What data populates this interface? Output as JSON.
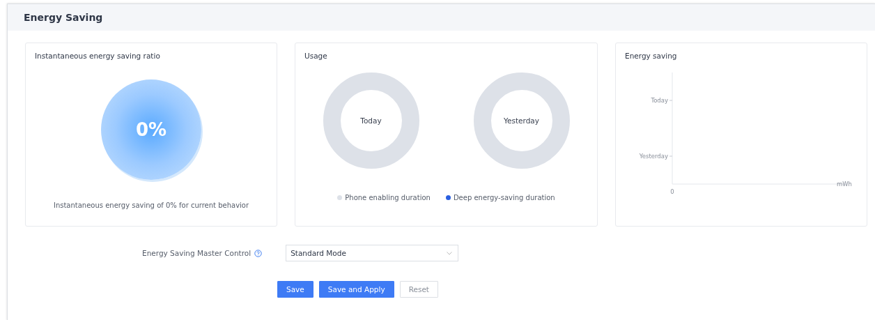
{
  "panel": {
    "title": "Energy Saving"
  },
  "ratio_card": {
    "title": "Instantaneous energy saving ratio",
    "value": "0%",
    "caption": "Instantaneous energy saving of 0% for current behavior"
  },
  "usage_card": {
    "title": "Usage",
    "donuts": [
      "Today",
      "Yesterday"
    ],
    "legend": [
      {
        "label": "Phone enabling duration",
        "color": "#dde1e8"
      },
      {
        "label": "Deep energy-saving duration",
        "color": "#2a5fe0"
      }
    ]
  },
  "saving_card": {
    "title": "Energy saving",
    "axis_categories": [
      "Today",
      "Yesterday"
    ],
    "axis_origin": "0",
    "axis_unit": "mWh"
  },
  "master_control": {
    "label": "Energy Saving Master Control",
    "value": "Standard Mode"
  },
  "buttons": [
    {
      "label": "Save",
      "kind": "primary"
    },
    {
      "label": "Save and Apply",
      "kind": "primary"
    },
    {
      "label": "Reset",
      "kind": "plain"
    }
  ]
}
